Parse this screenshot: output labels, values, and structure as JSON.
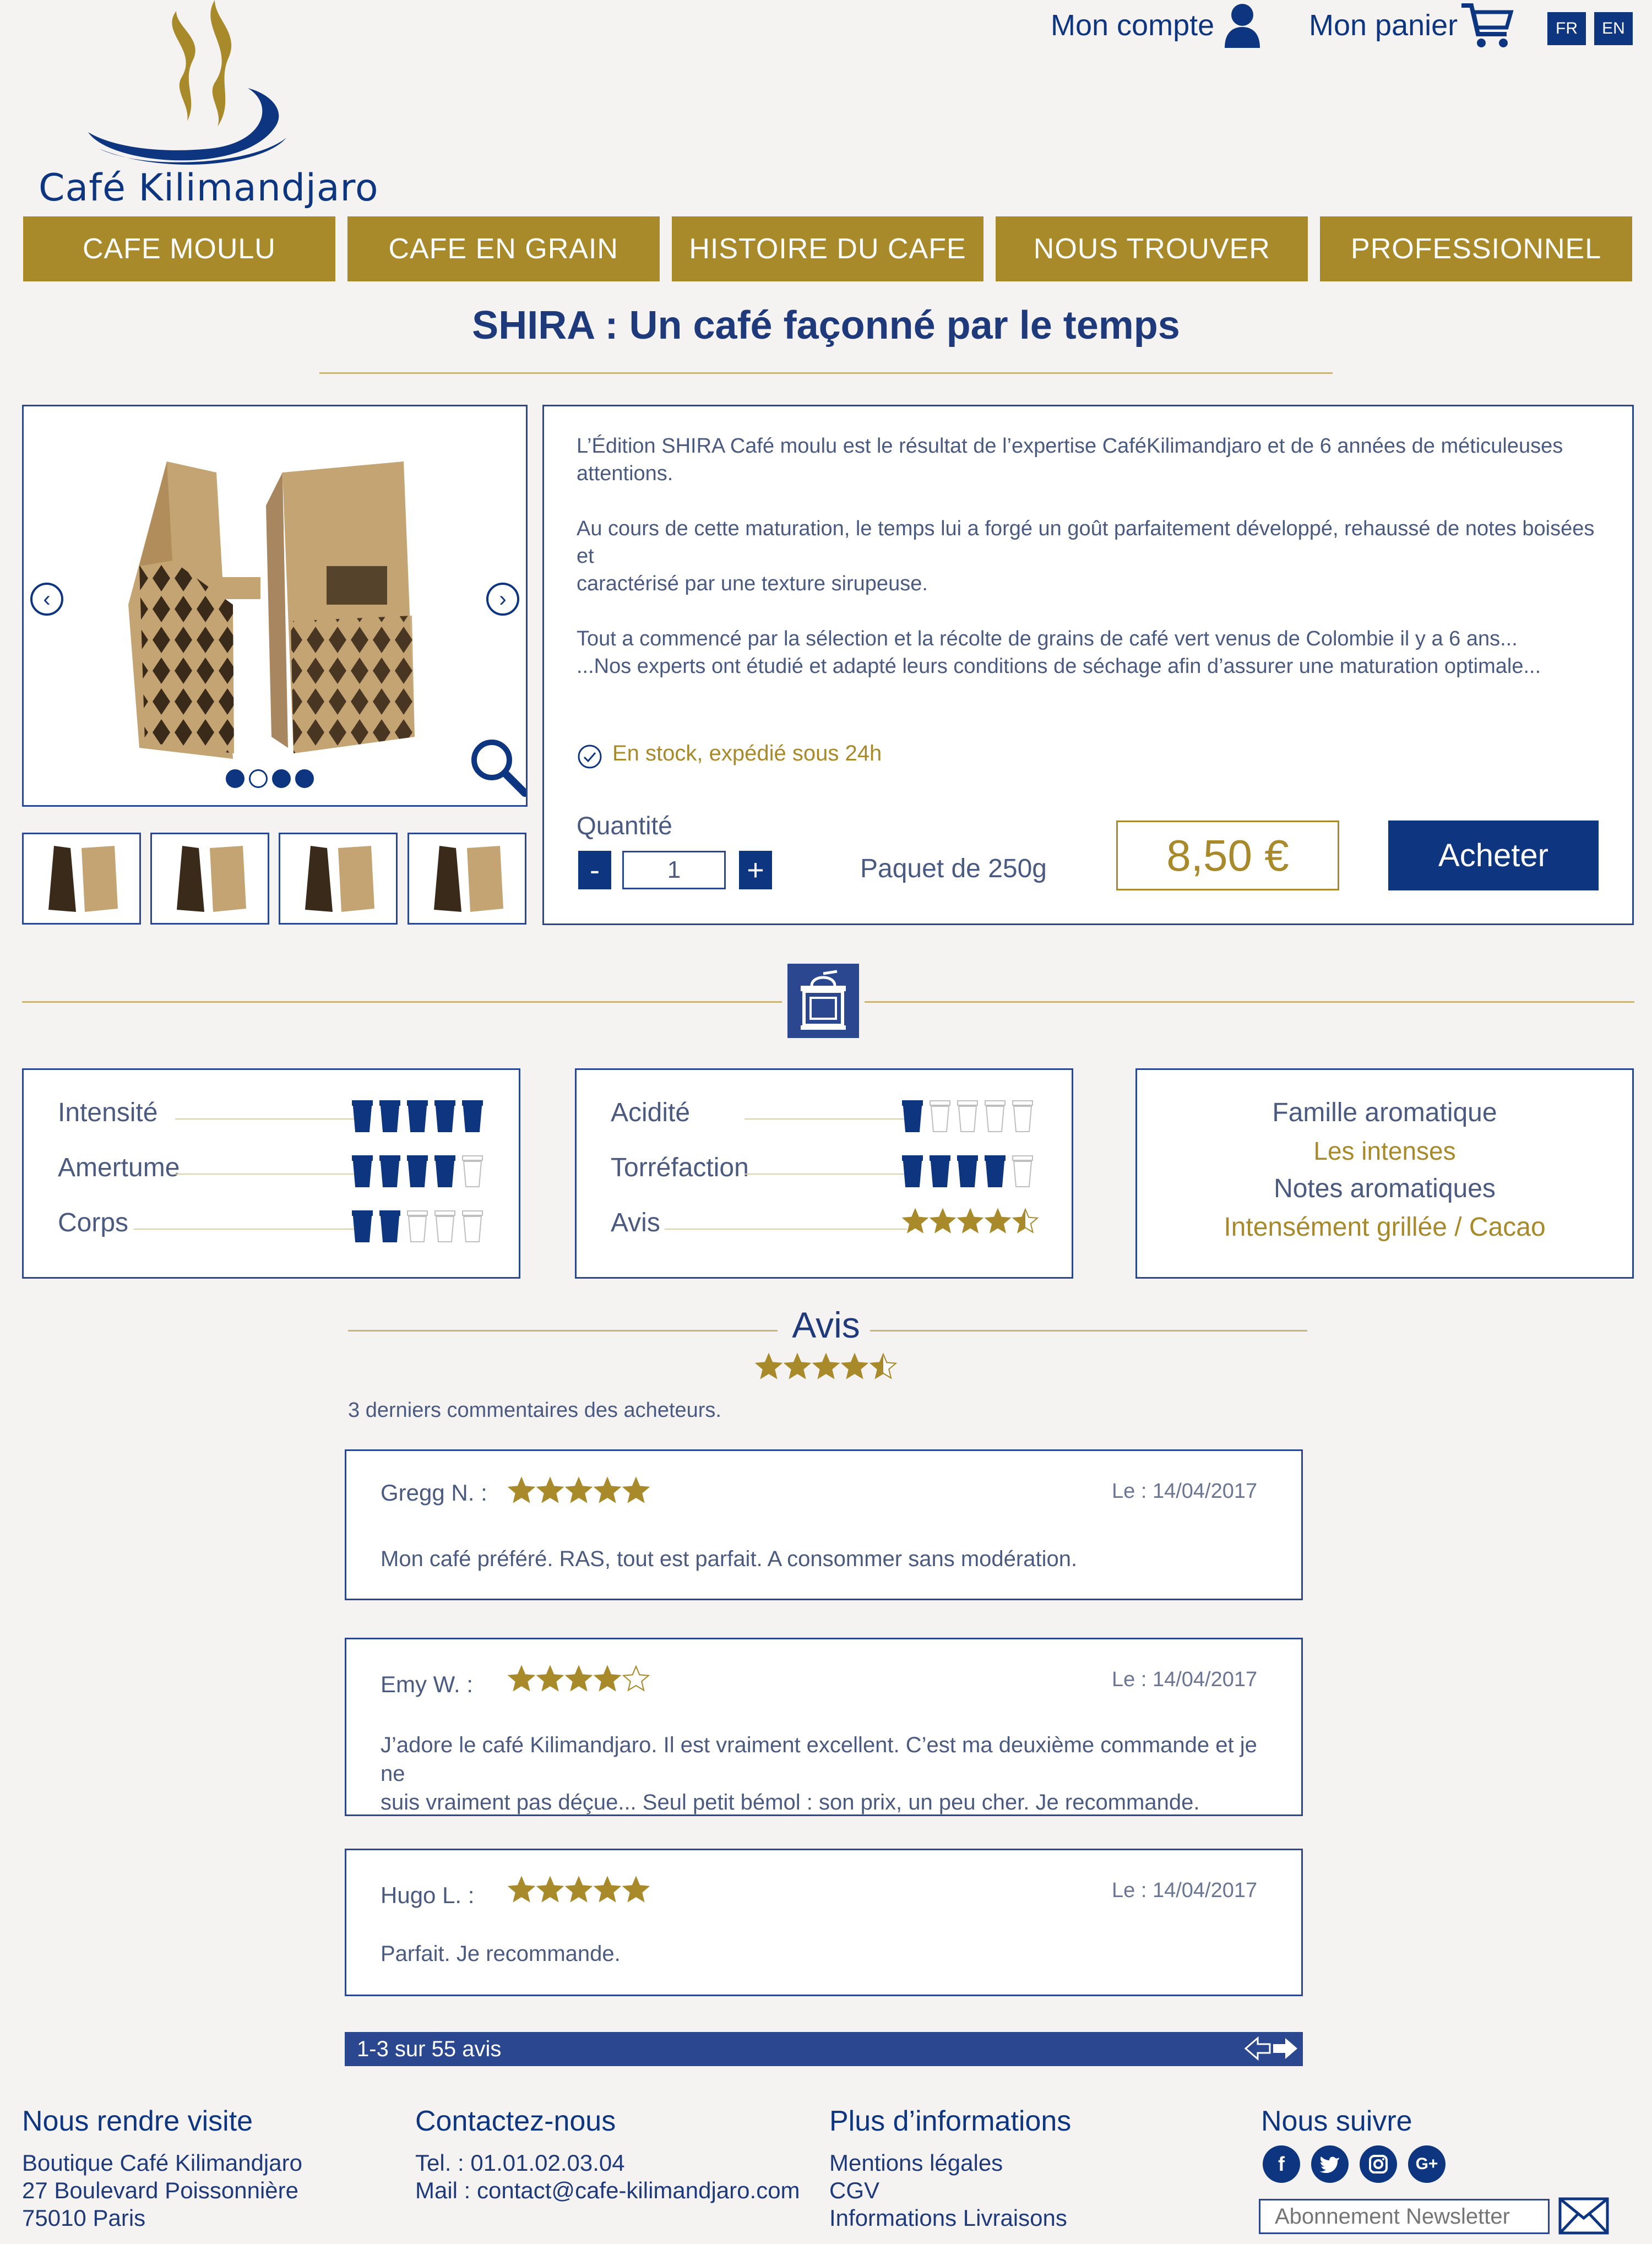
{
  "header": {
    "brand": "Café Kilimandjaro",
    "account_label": "Mon compte",
    "cart_label": "Mon panier",
    "lang_fr": "FR",
    "lang_en": "EN"
  },
  "nav": {
    "items": [
      {
        "label": "CAFE MOULU"
      },
      {
        "label": "CAFE EN GRAIN"
      },
      {
        "label": "HISTOIRE DU CAFE"
      },
      {
        "label": "NOUS TROUVER"
      },
      {
        "label": "PROFESSIONNEL"
      }
    ]
  },
  "product": {
    "title": "SHIRA : Un café façonné par le temps",
    "desc_p1": "L’Édition SHIRA Café moulu est le résultat de l’expertise CaféKilimandjaro et de 6 années de méticuleuses attentions.",
    "desc_p2a": "Au cours de cette maturation, le temps lui a forgé un goût parfaitement développé, rehaussé de notes boisées et",
    "desc_p2b": "caractérisé par une texture sirupeuse.",
    "desc_p3a": "Tout a commencé par la sélection et la récolte de grains de café vert venus de Colombie il y a 6 ans...",
    "desc_p3b": "...Nos experts ont étudié et adapté leurs conditions de séchage afin d’assurer une maturation optimale...",
    "stock": "En stock, expédié sous 24h",
    "quantity_label": "Quantité",
    "quantity_value": "1",
    "minus": "-",
    "plus": "+",
    "package": "Paquet de 250g",
    "price": "8,50 €",
    "buy_label": "Acheter",
    "gallery_active_index": 0,
    "gallery_count": 4
  },
  "taste": {
    "intensite": {
      "label": "Intensité",
      "level": 5,
      "max": 5
    },
    "amertume": {
      "label": "Amertume",
      "level": 4,
      "max": 5
    },
    "corps": {
      "label": "Corps",
      "level": 2,
      "max": 5
    },
    "acidite": {
      "label": "Acidité",
      "level": 1,
      "max": 5
    },
    "torrefaction": {
      "label": "Torréfaction",
      "level": 4,
      "max": 5
    },
    "avis": {
      "label": "Avis",
      "rating": 4.5,
      "max": 5
    },
    "famille_label": "Famille aromatique",
    "famille_value": "Les intenses",
    "notes_label": "Notes aromatiques",
    "notes_value": "Intensément grillée / Cacao"
  },
  "reviews": {
    "title": "Avis",
    "rating": 4.5,
    "subtitle": "3 derniers commentaires des acheteurs.",
    "items": [
      {
        "name": "Gregg N. :",
        "stars": 5,
        "date": "Le : 14/04/2017",
        "text1": "Mon café préféré. RAS, tout est parfait. A consommer sans modération.",
        "text2": ""
      },
      {
        "name": "Emy W. :",
        "stars": 4,
        "date": "Le : 14/04/2017",
        "text1": "J’adore le café Kilimandjaro. Il est vraiment excellent. C’est ma deuxième commande et je ne",
        "text2": "suis vraiment pas déçue... Seul petit bémol : son prix, un peu cher. Je recommande."
      },
      {
        "name": "Hugo L. :",
        "stars": 5,
        "date": "Le : 14/04/2017",
        "text1": "Parfait. Je recommande.",
        "text2": ""
      }
    ],
    "pager": "1-3 sur 55 avis"
  },
  "footer": {
    "visit_title": "Nous rendre visite",
    "visit_l1": "Boutique Café Kilimandjaro",
    "visit_l2": "27 Boulevard Poissonnière",
    "visit_l3": "75010 Paris",
    "contact_title": "Contactez-nous",
    "contact_tel": "Tel. : 01.01.02.03.04",
    "contact_mail": "Mail : contact@cafe-kilimandjaro.com",
    "info_title": "Plus d’informations",
    "info_l1": "Mentions légales",
    "info_l2": "CGV",
    "info_l3": "Informations Livraisons",
    "follow_title": "Nous suivre",
    "newsletter_placeholder": "Abonnement Newsletter"
  },
  "colors": {
    "navy": "#0e3680",
    "gold": "#a88a2a",
    "background": "#f5f3f1"
  }
}
